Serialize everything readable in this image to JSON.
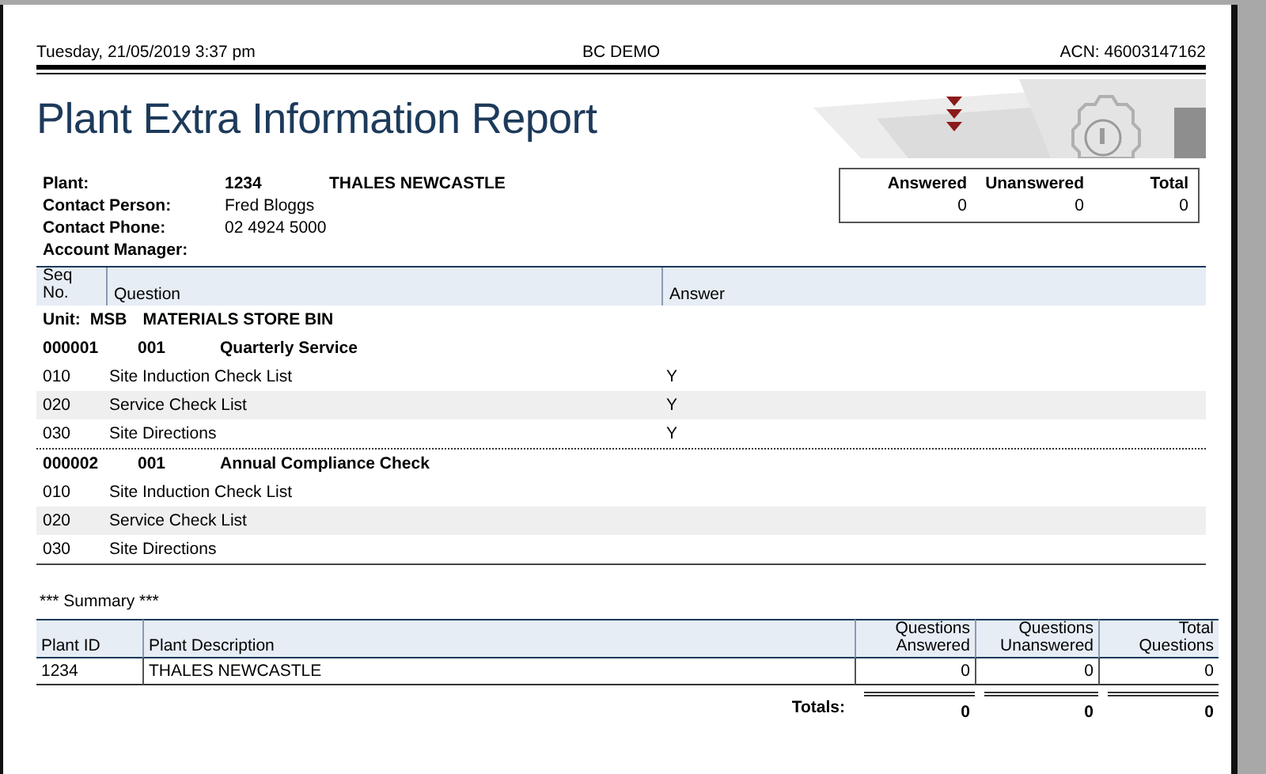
{
  "header": {
    "date": "Tuesday, 21/05/2019  3:37 pm",
    "company": "BC DEMO",
    "acn": "ACN: 46003147162"
  },
  "title": "Plant Extra Information Report",
  "plant_info": [
    {
      "label": "Plant:",
      "value": "1234",
      "extra": "THALES NEWCASTLE"
    },
    {
      "label": "Contact Person:",
      "value": "Fred Bloggs"
    },
    {
      "label": "Contact Phone:",
      "value": "02 4924 5000"
    },
    {
      "label": "Account Manager:"
    }
  ],
  "counts": [
    {
      "label": "Answered",
      "value": "0"
    },
    {
      "label": "Unanswered",
      "value": "0"
    },
    {
      "label": "Total",
      "value": "0"
    }
  ],
  "questions_table": {
    "columns": [
      "Seq No.",
      "Question",
      "Answer"
    ],
    "unit": {
      "label": "Unit:",
      "code": "MSB",
      "name": "MATERIALS STORE BIN"
    },
    "groups": [
      {
        "number": "000001",
        "seq": "001",
        "name": "Quarterly Service",
        "rows": [
          {
            "seq": "010",
            "question": "Site Induction Check List",
            "answer": "Y"
          },
          {
            "seq": "020",
            "question": "Service Check List",
            "answer": "Y"
          },
          {
            "seq": "030",
            "question": "Site Directions",
            "answer": "Y"
          }
        ]
      },
      {
        "number": "000002",
        "seq": "001",
        "name": "Annual Compliance Check",
        "rows": [
          {
            "seq": "010",
            "question": "Site Induction Check List"
          },
          {
            "seq": "020",
            "question": "Service Check List"
          },
          {
            "seq": "030",
            "question": "Site Directions"
          }
        ]
      }
    ]
  },
  "summary": {
    "title": "*** Summary ***",
    "columns": [
      "Plant ID",
      "Plant Description",
      "Questions Answered",
      "Questions Unanswered",
      "Total Questions"
    ],
    "rows": [
      {
        "cells": [
          "1234",
          "THALES NEWCASTLE",
          "0",
          "0",
          "0"
        ]
      }
    ],
    "totals_label": "Totals:",
    "totals": [
      "0",
      "0",
      "0"
    ]
  }
}
